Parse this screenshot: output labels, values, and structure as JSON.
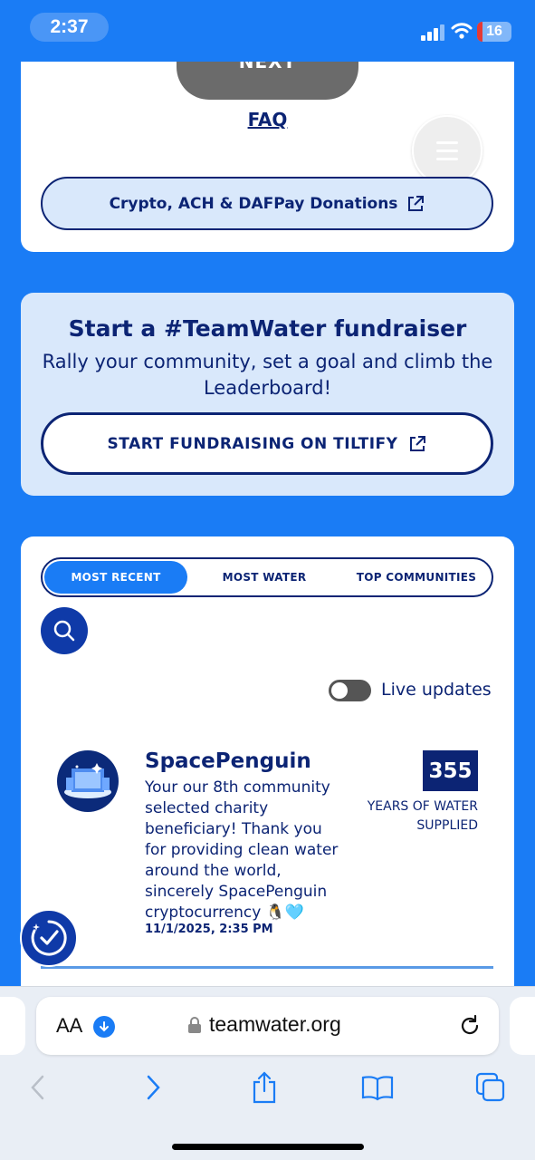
{
  "status_bar": {
    "time": "2:37",
    "battery": "16"
  },
  "donate_card": {
    "next_label": "NEXT",
    "faq_label": "FAQ",
    "crypto_label": "Crypto, ACH & DAFPay Donations"
  },
  "fundraiser_card": {
    "title": "Start a #TeamWater fundraiser",
    "subtitle": "Rally your community, set a goal and climb the Leaderboard!",
    "button_label": "START FUNDRAISING ON TILTIFY"
  },
  "leaderboard": {
    "tabs": [
      {
        "label": "MOST RECENT",
        "active": true
      },
      {
        "label": "MOST WATER",
        "active": false
      },
      {
        "label": "TOP COMMUNITIES",
        "active": false
      }
    ],
    "live_updates_label": "Live updates",
    "live_updates_on": false,
    "entries": [
      {
        "name": "SpacePenguin",
        "message": "Your our 8th community selected charity beneficiary! Thank you for providing clean water around the world, sincerely SpacePenguin cryptocurrency 🐧🩵",
        "date": "11/1/2025, 2:35 PM",
        "years": "355",
        "years_label": "YEARS OF WATER SUPPLIED"
      }
    ]
  },
  "browser": {
    "aa_label": "AA",
    "url": "teamwater.org"
  },
  "colors": {
    "background": "#1a7cf5",
    "navy": "#0c2474",
    "light_blue": "#d9e8fb"
  }
}
